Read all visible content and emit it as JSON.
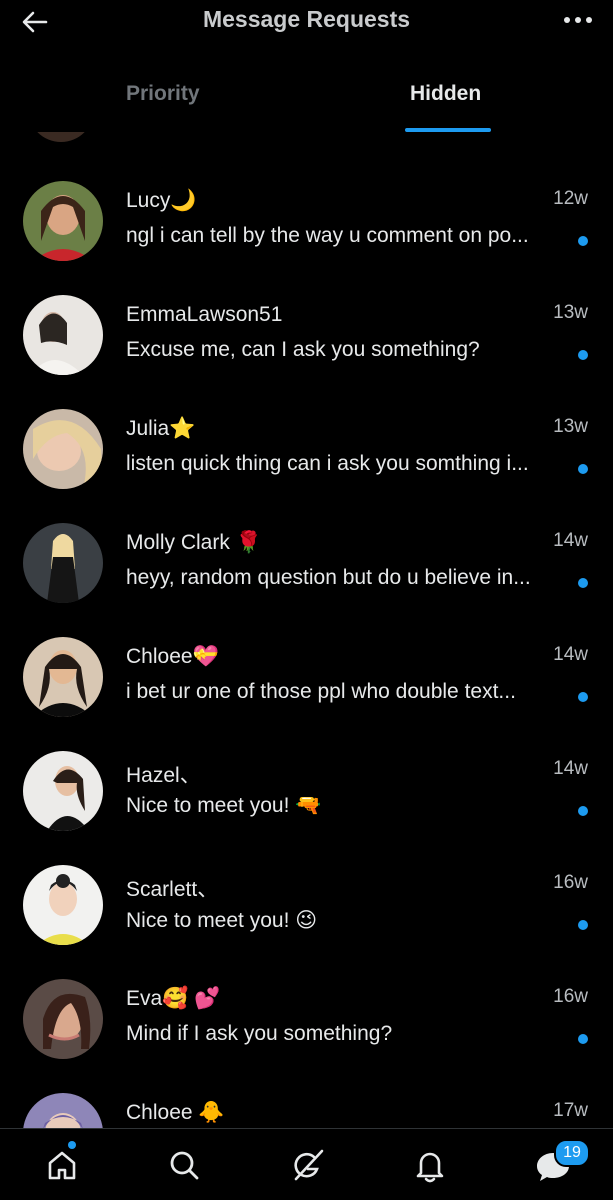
{
  "header": {
    "title": "Message Requests",
    "back_icon": "arrow-left-icon",
    "more_icon": "more-horizontal-icon"
  },
  "tabs": [
    {
      "label": "Priority",
      "active": false
    },
    {
      "label": "Hidden",
      "active": true
    }
  ],
  "accent_color": "#1d9bf0",
  "conversations": [
    {
      "name": "Lucy🌙",
      "preview": "ngl i can tell by the way u comment on po...",
      "time": "12w",
      "unread": true
    },
    {
      "name": "EmmaLawson51",
      "preview": "Excuse me, can I ask you something?",
      "time": "13w",
      "unread": true
    },
    {
      "name": "Julia⭐",
      "preview": "listen quick thing can i ask you somthing i...",
      "time": "13w",
      "unread": true
    },
    {
      "name": "Molly Clark 🌹",
      "preview": "heyy, random question but do u believe in...",
      "time": "14w",
      "unread": true
    },
    {
      "name": "Chloee💝",
      "preview": "i bet ur one of those ppl who double text...",
      "time": "14w",
      "unread": true
    },
    {
      "name": "Hazel、",
      "preview": "Nice to meet you! 🔫",
      "time": "14w",
      "unread": true
    },
    {
      "name": "Scarlett、",
      "preview": "Nice to meet you! 😉",
      "time": "16w",
      "unread": true
    },
    {
      "name": "Eva🥰 💕",
      "preview": "Mind if I ask you something?",
      "time": "16w",
      "unread": true
    },
    {
      "name": "Chloee 🐥",
      "preview": "",
      "time": "17w",
      "unread": false
    }
  ],
  "nav": {
    "items": [
      "home-icon",
      "search-icon",
      "grok-icon",
      "bell-icon",
      "messages-icon"
    ],
    "messages_badge": "19"
  }
}
